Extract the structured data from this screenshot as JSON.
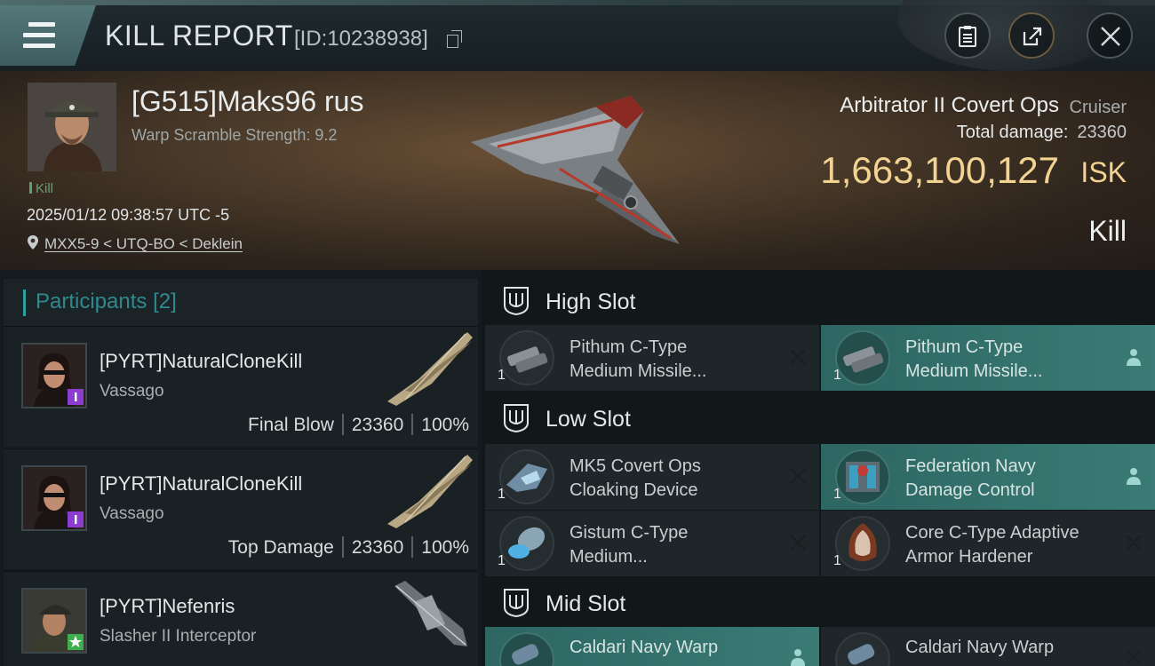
{
  "header": {
    "title": "KILL REPORT",
    "id_text": "[ID:10238938]"
  },
  "victim": {
    "name": "[G515]Maks96 rus",
    "warp_scramble": "Warp Scramble Strength: 9.2",
    "status": "Kill",
    "datetime": "2025/01/12 09:38:57 UTC -5",
    "location": "MXX5-9 < UTQ-BO < Deklein",
    "ship_name": "Arbitrator II Covert Ops",
    "ship_class": "Cruiser",
    "total_damage_label": "Total damage:",
    "total_damage_value": "23360",
    "isk_value": "1,663,100,127",
    "isk_unit": "ISK",
    "result": "Kill"
  },
  "participants": {
    "label": "Participants",
    "count": "[2]",
    "items": [
      {
        "name": "[PYRT]NaturalCloneKill",
        "ship": "Vassago",
        "role": "Final Blow",
        "damage": "23360",
        "percent": "100%"
      },
      {
        "name": "[PYRT]NaturalCloneKill",
        "ship": "Vassago",
        "role": "Top Damage",
        "damage": "23360",
        "percent": "100%"
      },
      {
        "name": "[PYRT]Nefenris",
        "ship": "Slasher II Interceptor"
      }
    ]
  },
  "fitting": {
    "high_slot": {
      "title": "High Slot",
      "modules": [
        {
          "qty": "1",
          "name_l1": "Pithum C-Type",
          "name_l2": "Medium Missile..."
        },
        {
          "qty": "1",
          "name_l1": "Pithum C-Type",
          "name_l2": "Medium Missile..."
        }
      ]
    },
    "low_slot": {
      "title": "Low Slot",
      "modules": [
        {
          "qty": "1",
          "name_l1": "MK5 Covert Ops",
          "name_l2": "Cloaking Device"
        },
        {
          "qty": "1",
          "name_l1": "Federation Navy",
          "name_l2": "Damage Control"
        },
        {
          "qty": "1",
          "name_l1": "Gistum C-Type",
          "name_l2": "Medium..."
        },
        {
          "qty": "1",
          "name_l1": "Core C-Type Adaptive",
          "name_l2": "Armor Hardener"
        }
      ]
    },
    "mid_slot": {
      "title": "Mid Slot",
      "modules": [
        {
          "name_l1": "Caldari Navy Warp"
        },
        {
          "name_l1": "Caldari Navy Warp"
        }
      ]
    }
  },
  "colors": {
    "accent_teal": "#2f9ea0",
    "isk_gold": "#f2d392",
    "highlight_module": "#3a7b75"
  }
}
